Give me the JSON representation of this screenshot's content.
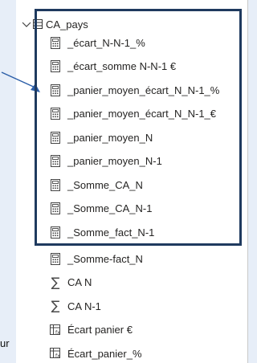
{
  "table": {
    "name": "CA_pays"
  },
  "highlighted_items": [
    {
      "label": "_écart_N-N-1_%",
      "icon": "calculator-icon"
    },
    {
      "label": "_écart_somme N-N-1 €",
      "icon": "calculator-icon"
    },
    {
      "label": "_panier_moyen_écart_N_N-1_%",
      "icon": "calculator-icon"
    },
    {
      "label": "_panier_moyen_écart_N_N-1_€",
      "icon": "calculator-icon"
    },
    {
      "label": "_panier_moyen_N",
      "icon": "calculator-icon"
    },
    {
      "label": "_panier_moyen_N-1",
      "icon": "calculator-icon"
    },
    {
      "label": "_Somme_CA_N",
      "icon": "calculator-icon"
    },
    {
      "label": "_Somme_CA_N-1",
      "icon": "calculator-icon"
    },
    {
      "label": "_Somme_fact_N-1",
      "icon": "calculator-icon"
    }
  ],
  "other_items": [
    {
      "label": "_Somme-fact_N",
      "icon": "calculator-icon"
    },
    {
      "label": "CA N",
      "icon": "sigma-icon"
    },
    {
      "label": "CA N-1",
      "icon": "sigma-icon"
    },
    {
      "label": "Écart panier €",
      "icon": "calculated-column-icon"
    },
    {
      "label": "Écart_panier_%",
      "icon": "calculated-column-icon"
    }
  ],
  "bottom_fragment": "ur",
  "colors": {
    "highlight_border": "#1f3a5f",
    "arrow": "#2b5ea8",
    "pane_bg": "#ffffff",
    "page_bg": "#e7eef8"
  }
}
